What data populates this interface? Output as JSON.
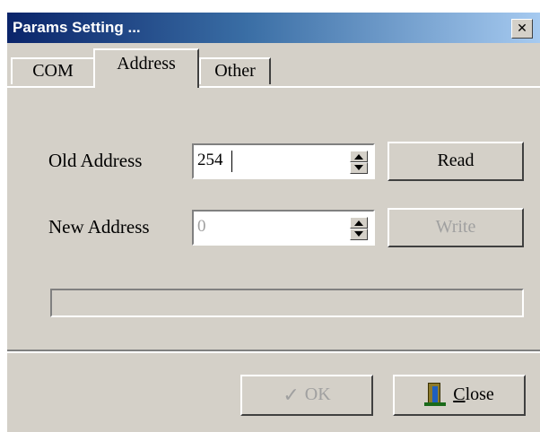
{
  "window": {
    "title": "Params Setting ...",
    "close_glyph": "✕"
  },
  "tabs": [
    {
      "label": "COM",
      "active": false
    },
    {
      "label": "Address",
      "active": true
    },
    {
      "label": "Other",
      "active": false
    }
  ],
  "address_tab": {
    "old_address": {
      "label": "Old Address",
      "value": "254",
      "enabled": true
    },
    "new_address": {
      "label": "New Address",
      "value": "0",
      "enabled": false
    },
    "read_button": {
      "label": "Read",
      "enabled": true
    },
    "write_button": {
      "label": "Write",
      "enabled": false
    }
  },
  "footer": {
    "ok_button": {
      "label": "OK",
      "icon": "checkmark-icon",
      "enabled": false
    },
    "close_button": {
      "label_first": "C",
      "label_rest": "lose",
      "icon": "exit-door-icon",
      "enabled": true
    }
  },
  "colors": {
    "face": "#d4d0c8",
    "title_start": "#0a246a",
    "title_end": "#a6caf0",
    "disabled_text": "#a0a0a0"
  }
}
